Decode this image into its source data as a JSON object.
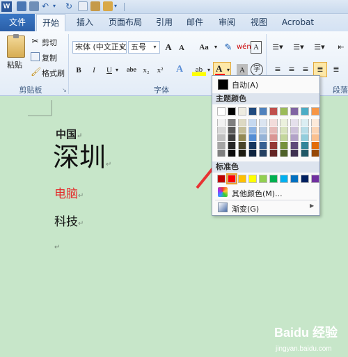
{
  "app": {
    "logo_letter": "W"
  },
  "tabs": {
    "file": "文件",
    "items": [
      "开始",
      "插入",
      "页面布局",
      "引用",
      "邮件",
      "审阅",
      "视图",
      "Acrobat"
    ]
  },
  "ribbon": {
    "clipboard": {
      "paste": "粘贴",
      "cut": "剪切",
      "copy": "复制",
      "format_painter": "格式刷",
      "group": "剪贴板"
    },
    "font": {
      "font_name": "宋体 (中文正文",
      "font_size": "五号",
      "grow": "A",
      "shrink": "A",
      "change_case": "Aa",
      "bold": "B",
      "italic": "I",
      "underline": "U",
      "strike": "abe",
      "subscript": "x₂",
      "superscript": "x²",
      "font_color": "A",
      "char_shading": "A",
      "enclose": "字",
      "group": "字体"
    },
    "paragraph": {
      "group": "段落"
    }
  },
  "document": {
    "line1": "中国",
    "line2": "深圳",
    "line3": "电脑",
    "line4": "科技",
    "para_mark": "↵"
  },
  "palette": {
    "automatic": "自动(A)",
    "theme_header": "主题颜色",
    "standard_header": "标准色",
    "more_colors": "其他颜色(M)...",
    "gradient": "渐变(G)",
    "theme_top": [
      "#ffffff",
      "#000000",
      "#eeece1",
      "#1f497d",
      "#4f81bd",
      "#c0504d",
      "#9bbb59",
      "#8064a2",
      "#4bacc6",
      "#f79646"
    ],
    "theme_cols": [
      [
        "#f2f2f2",
        "#d8d8d8",
        "#bfbfbf",
        "#a5a5a5",
        "#7f7f7f"
      ],
      [
        "#7f7f7f",
        "#595959",
        "#3f3f3f",
        "#262626",
        "#0c0c0c"
      ],
      [
        "#ddd9c3",
        "#c4bd97",
        "#938953",
        "#494429",
        "#1d1b10"
      ],
      [
        "#c6d9f0",
        "#8db3e2",
        "#548dd4",
        "#17365d",
        "#0f243e"
      ],
      [
        "#dbe5f1",
        "#b8cce4",
        "#95b3d7",
        "#366092",
        "#244061"
      ],
      [
        "#f2dcdb",
        "#e5b9b7",
        "#d99694",
        "#953734",
        "#632423"
      ],
      [
        "#ebf1dd",
        "#d7e3bc",
        "#c3d69b",
        "#76923c",
        "#4f6128"
      ],
      [
        "#e5e0ec",
        "#ccc1d9",
        "#b2a2c7",
        "#5f497a",
        "#3f3151"
      ],
      [
        "#dbeef3",
        "#b7dde8",
        "#92cddc",
        "#31859b",
        "#205867"
      ],
      [
        "#fdeada",
        "#fbd5b5",
        "#fac08f",
        "#e36c09",
        "#974806"
      ]
    ],
    "standard": [
      "#c00000",
      "#ff0000",
      "#ffc000",
      "#ffff00",
      "#92d050",
      "#00b050",
      "#00b0f0",
      "#0070c0",
      "#002060",
      "#7030a0"
    ],
    "selected_standard_index": 1
  },
  "watermark": {
    "logo": "Baidu 经验",
    "url": "jingyan.baidu.com"
  }
}
